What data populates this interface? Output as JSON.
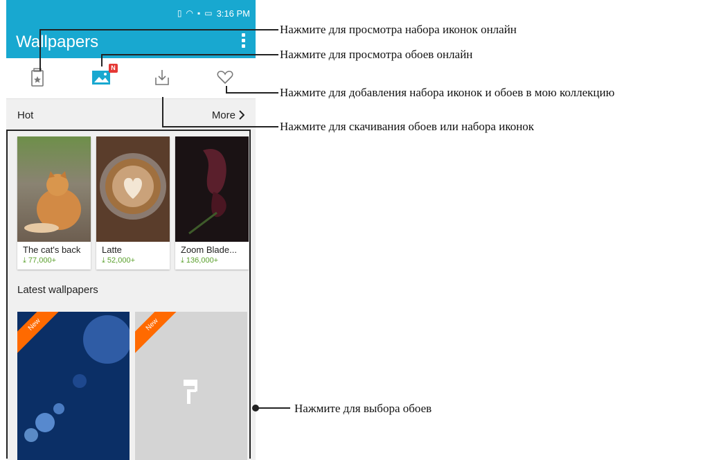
{
  "status": {
    "time": "3:16 PM"
  },
  "app": {
    "title": "Wallpapers"
  },
  "tabs": [
    {
      "icon": "icon-pack-icon"
    },
    {
      "icon": "wallpaper-icon",
      "badge": "N"
    },
    {
      "icon": "download-icon"
    },
    {
      "icon": "heart-icon"
    }
  ],
  "hot": {
    "label": "Hot",
    "more": "More"
  },
  "cards": [
    {
      "name": "The cat's back",
      "downloads": "77,000+"
    },
    {
      "name": "Latte",
      "downloads": "52,000+"
    },
    {
      "name": "Zoom Blade...",
      "downloads": "136,000+"
    }
  ],
  "latest": {
    "title": "Latest wallpapers",
    "badge": "New"
  },
  "callouts": {
    "icon_packs": "Нажмите для просмотра набора иконок онлайн",
    "wallpapers": "Нажмите для просмотра обоев онлайн",
    "collection": "Нажмите для добавления набора иконок и обоев в мою коллекцию",
    "download": "Нажмите для скачивания обоев или набора иконок",
    "select": "Нажмите для выбора обоев"
  },
  "colors": {
    "accent": "#18a8d0",
    "badge": "#e53935",
    "ribbon": "#ff6a00",
    "download_green": "#5aa02c"
  }
}
